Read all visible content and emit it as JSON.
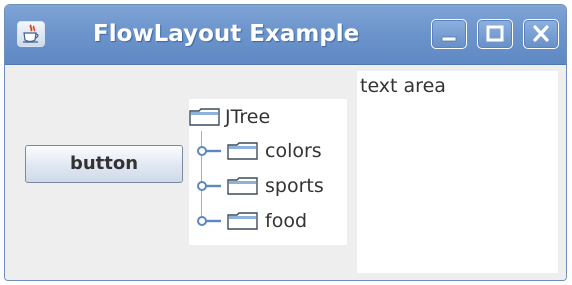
{
  "window": {
    "title": "FlowLayout Example",
    "controls": {
      "minimize": "minimize",
      "maximize": "maximize",
      "close": "close"
    }
  },
  "button": {
    "label": "button"
  },
  "tree": {
    "root": "JTree",
    "children": [
      "colors",
      "sports",
      "food"
    ]
  },
  "text_area": {
    "value": "text area"
  },
  "icons": {
    "app": "java-cup-icon",
    "folder": "folder-icon",
    "handle": "tree-expand-handle-icon"
  },
  "colors": {
    "titlebar": "#6d95cc",
    "background": "#eeeeee",
    "tree_line": "#9bb0cd"
  }
}
